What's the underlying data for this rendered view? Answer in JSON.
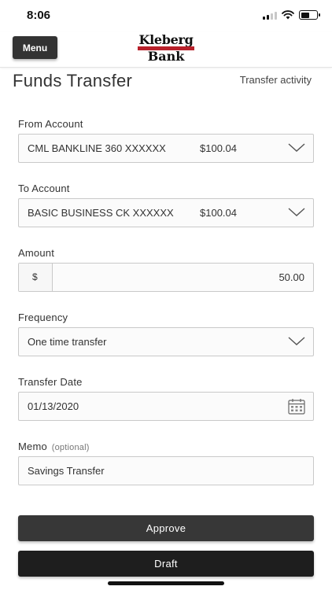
{
  "status_bar": {
    "time": "8:06"
  },
  "header": {
    "menu_label": "Menu",
    "logo_top": "Kleberg",
    "logo_bottom": "Bank"
  },
  "page": {
    "title": "Funds Transfer",
    "activity_link": "Transfer activity"
  },
  "form": {
    "from_account": {
      "label": "From Account",
      "account_name": "CML BANKLINE 360 XXXXXX",
      "balance": "$100.04"
    },
    "to_account": {
      "label": "To Account",
      "account_name": "BASIC BUSINESS CK XXXXXX",
      "balance": "$100.04"
    },
    "amount": {
      "label": "Amount",
      "currency": "$",
      "value": "50.00"
    },
    "frequency": {
      "label": "Frequency",
      "value": "One time transfer"
    },
    "transfer_date": {
      "label": "Transfer Date",
      "value": "01/13/2020"
    },
    "memo": {
      "label": "Memo",
      "optional_note": "(optional)",
      "value": "Savings Transfer"
    }
  },
  "actions": {
    "approve_label": "Approve",
    "draft_label": "Draft"
  },
  "colors": {
    "brand_red": "#b8202a",
    "button_dark": "#373737",
    "button_darker": "#1e1e1e"
  }
}
